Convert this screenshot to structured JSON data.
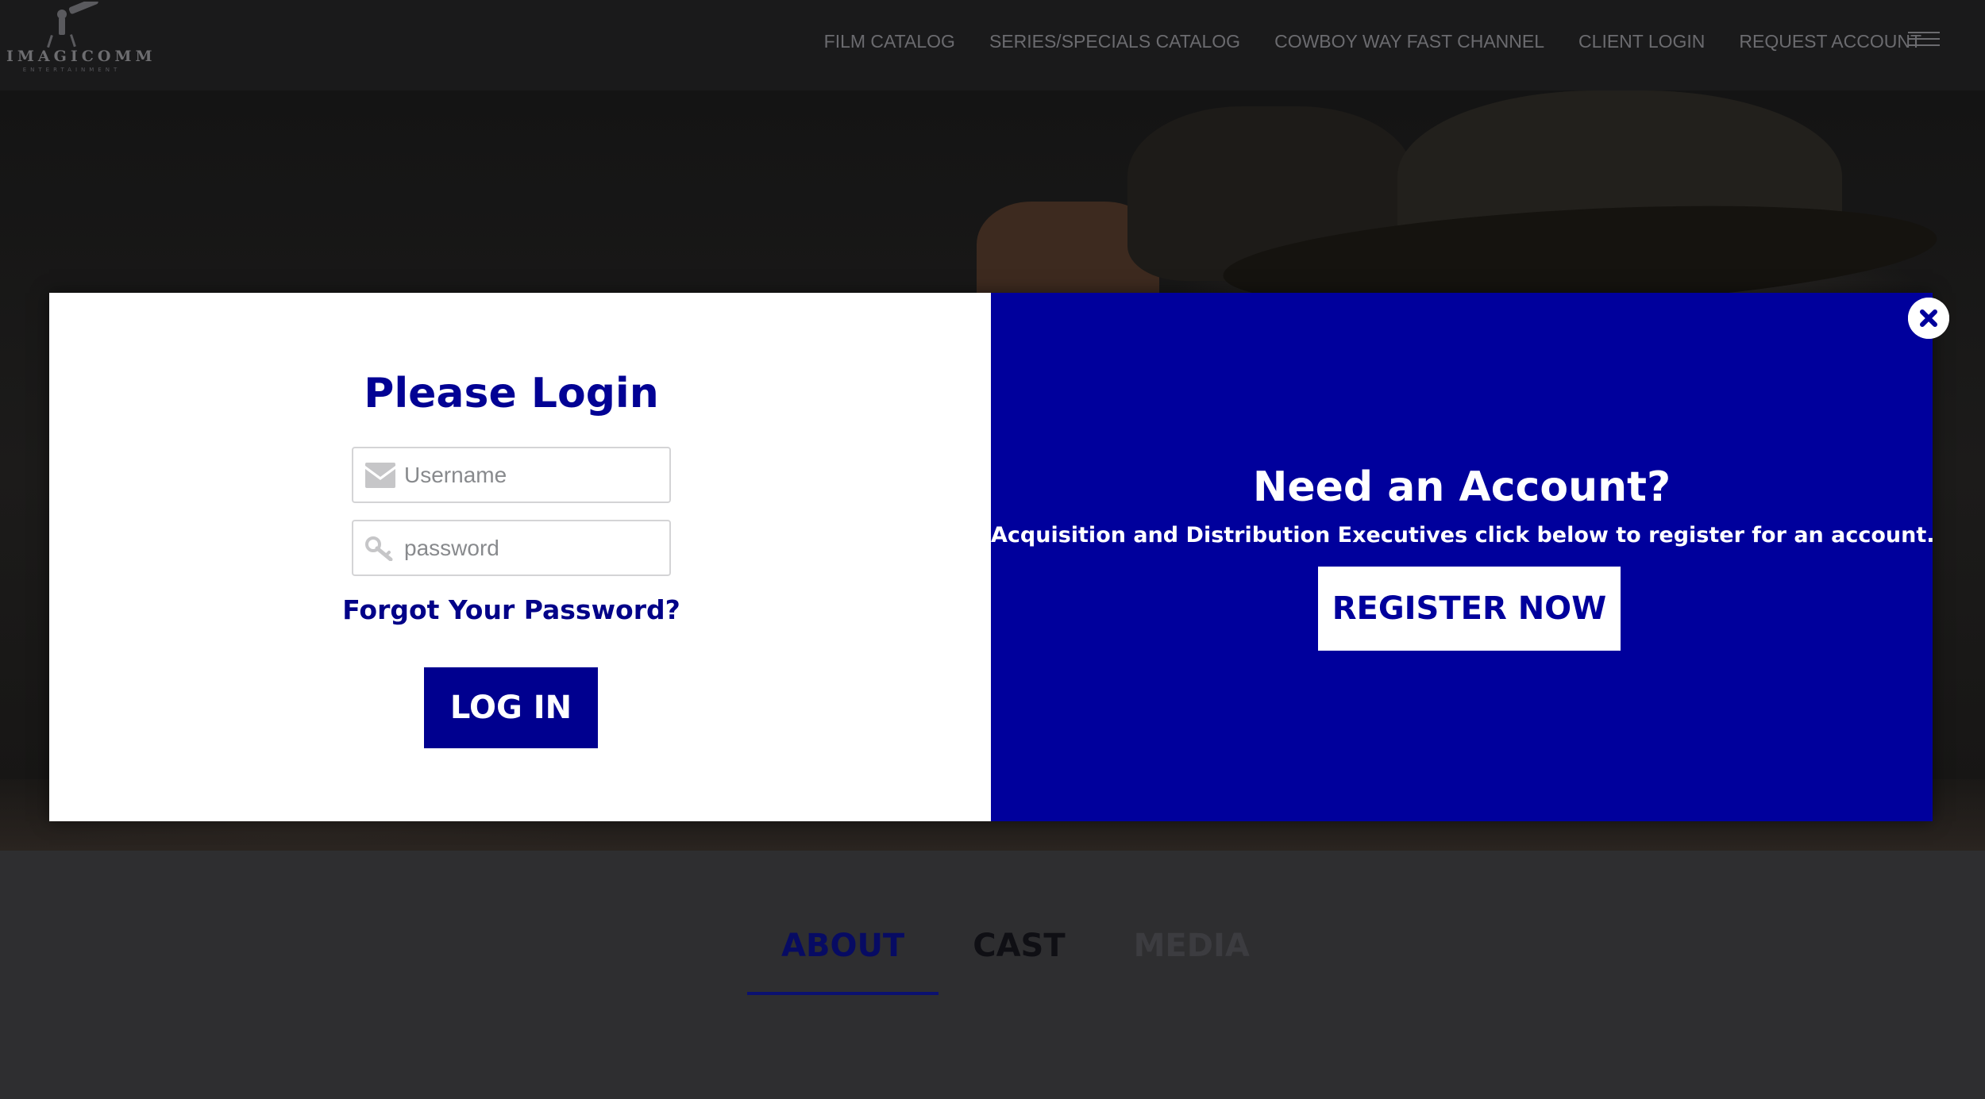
{
  "header": {
    "logo": {
      "name": "IMAGICOMM",
      "subtitle": "ENTERTAINMENT"
    },
    "nav": [
      {
        "label": "FILM CATALOG"
      },
      {
        "label": "SERIES/SPECIALS CATALOG"
      },
      {
        "label": "COWBOY WAY FAST CHANNEL"
      },
      {
        "label": "CLIENT LOGIN"
      },
      {
        "label": "REQUEST ACCOUNT"
      }
    ],
    "menu_icon": "hamburger-icon"
  },
  "modal": {
    "login": {
      "title": "Please Login",
      "username_placeholder": "Username",
      "username_icon": "envelope-icon",
      "password_placeholder": "password",
      "password_icon": "key-icon",
      "forgot_label": "Forgot Your Password?",
      "login_label": "LOG IN"
    },
    "register": {
      "title": "Need an Account?",
      "subtitle": "Acquisition and Distribution Executives click below to register for an account.",
      "button_label": "REGISTER NOW"
    },
    "close_icon": "close-icon"
  },
  "tabs": [
    {
      "label": "ABOUT",
      "active": true
    },
    {
      "label": "CAST",
      "active": false
    },
    {
      "label": "MEDIA",
      "active": false
    }
  ],
  "colors": {
    "brand_blue": "#00009c",
    "header_bg": "#1a1a1b",
    "page_bg": "#2e2e30",
    "nav_text": "#6b6b6f"
  }
}
